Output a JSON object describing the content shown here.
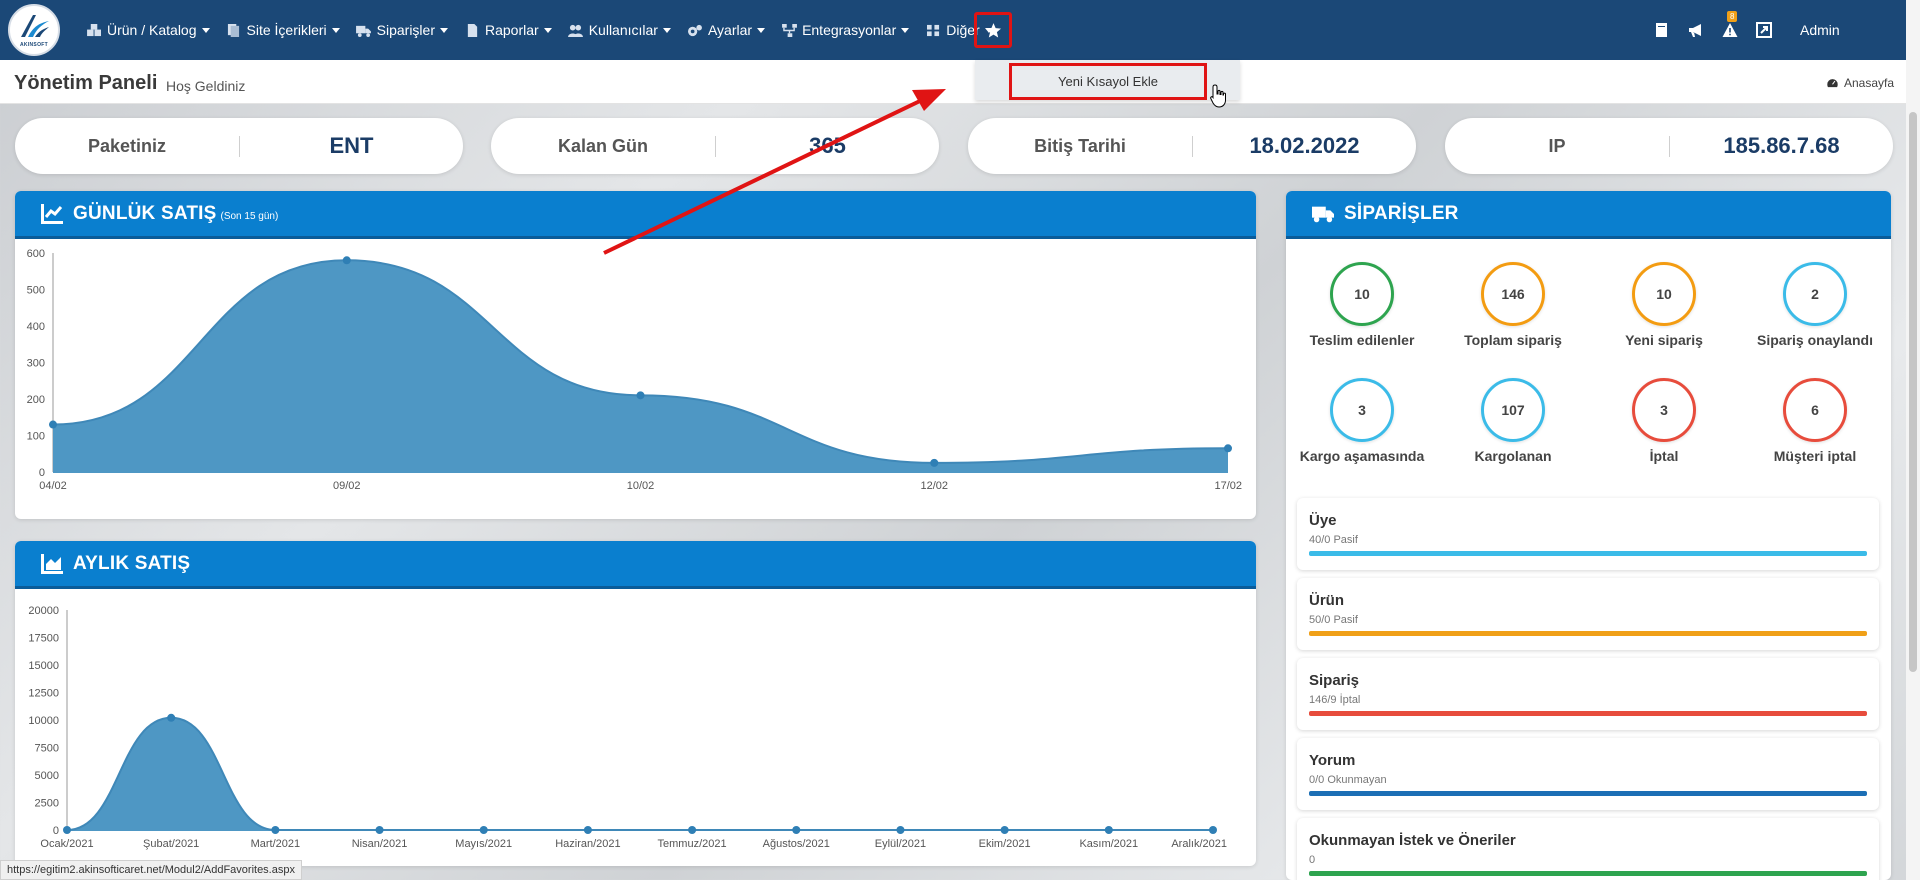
{
  "nav": {
    "items": [
      {
        "label": "Ürün / Katalog",
        "icon": "boxes-icon"
      },
      {
        "label": "Site İçerikleri",
        "icon": "pages-icon"
      },
      {
        "label": "Siparişler",
        "icon": "truck-icon"
      },
      {
        "label": "Raporlar",
        "icon": "file-icon"
      },
      {
        "label": "Kullanıcılar",
        "icon": "users-icon"
      },
      {
        "label": "Ayarlar",
        "icon": "cogs-icon"
      },
      {
        "label": "Entegrasyonlar",
        "icon": "sitemap-icon"
      },
      {
        "label": "Diğer",
        "icon": "grid-icon"
      }
    ],
    "favorites_icon": "star-icon",
    "alert_badge": "8",
    "user": "Admin"
  },
  "dropdown": {
    "item": "Yeni Kısayol Ekle"
  },
  "header": {
    "title": "Yönetim Paneli",
    "subtitle": "Hoş Geldiniz",
    "home_link": "Anasayfa"
  },
  "info": [
    {
      "label": "Paketiniz",
      "value": "ENT"
    },
    {
      "label": "Kalan Gün",
      "value": "365"
    },
    {
      "label": "Bitiş Tarihi",
      "value": "18.02.2022"
    },
    {
      "label": "IP",
      "value": "185.86.7.68"
    }
  ],
  "daily": {
    "title": "GÜNLÜK SATIŞ",
    "subtitle": "(Son 15 gün)"
  },
  "monthly": {
    "title": "AYLIK SATIŞ"
  },
  "chart_data": [
    {
      "type": "area",
      "title": "GÜNLÜK SATIŞ",
      "categories": [
        "04/02",
        "09/02",
        "10/02",
        "12/02",
        "17/02"
      ],
      "values": [
        130,
        580,
        210,
        25,
        65
      ],
      "ylim": [
        0,
        600
      ],
      "yticks": [
        0,
        100,
        200,
        300,
        400,
        500,
        600
      ],
      "color": "#4e97c4"
    },
    {
      "type": "area",
      "title": "AYLIK SATIŞ",
      "categories": [
        "Ocak/2021",
        "Şubat/2021",
        "Mart/2021",
        "Nisan/2021",
        "Mayıs/2021",
        "Haziran/2021",
        "Temmuz/2021",
        "Ağustos/2021",
        "Eylül/2021",
        "Ekim/2021",
        "Kasım/2021",
        "Aralık/2021"
      ],
      "values": [
        0,
        10200,
        0,
        0,
        0,
        0,
        0,
        0,
        0,
        0,
        0,
        0
      ],
      "ylim": [
        0,
        20000
      ],
      "yticks": [
        0,
        2500,
        5000,
        7500,
        10000,
        12500,
        15000,
        17500,
        20000
      ],
      "color": "#4e97c4"
    }
  ],
  "orders": {
    "title": "SİPARİŞLER",
    "circles": [
      {
        "value": "10",
        "label": "Teslim edilenler",
        "color": "#2ea44f"
      },
      {
        "value": "146",
        "label": "Toplam sipariş",
        "color": "#f39c12"
      },
      {
        "value": "10",
        "label": "Yeni sipariş",
        "color": "#f39c12"
      },
      {
        "value": "2",
        "label": "Sipariş onaylandı",
        "color": "#3bbbe8"
      },
      {
        "value": "3",
        "label": "Kargo aşamasında",
        "color": "#3bbbe8"
      },
      {
        "value": "107",
        "label": "Kargolanan",
        "color": "#3bbbe8"
      },
      {
        "value": "3",
        "label": "İptal",
        "color": "#e74c3c"
      },
      {
        "value": "6",
        "label": "Müşteri iptal",
        "color": "#e74c3c"
      }
    ]
  },
  "stats": [
    {
      "title": "Üye",
      "sub": "40/0 Pasif",
      "color": "#3bbbe8"
    },
    {
      "title": "Ürün",
      "sub": "50/0 Pasif",
      "color": "#f0a018"
    },
    {
      "title": "Sipariş",
      "sub": "146/9 İptal",
      "color": "#e74c3c"
    },
    {
      "title": "Yorum",
      "sub": "0/0 Okunmayan",
      "color": "#1c6fb5"
    },
    {
      "title": "Okunmayan İstek ve Öneriler",
      "sub": "0",
      "color": "#2ea44f"
    }
  ],
  "status_url": "https://egitim2.akinsofticaret.net/Modul2/AddFavorites.aspx"
}
